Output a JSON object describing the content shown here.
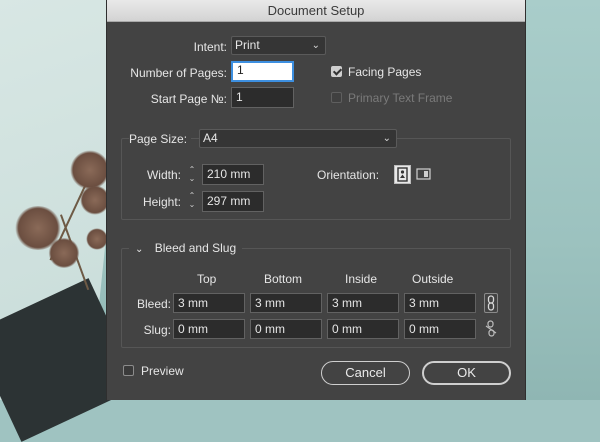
{
  "window": {
    "title": "Document Setup"
  },
  "intent": {
    "label": "Intent:",
    "value": "Print"
  },
  "pages": {
    "label": "Number of Pages:",
    "value": "1"
  },
  "start_page": {
    "label": "Start Page №:",
    "value": "1"
  },
  "facing_pages": {
    "label": "Facing Pages",
    "checked": true
  },
  "primary_text_frame": {
    "label": "Primary Text Frame",
    "checked": false,
    "disabled": true
  },
  "page_size": {
    "label": "Page Size:",
    "value": "A4"
  },
  "width": {
    "label": "Width:",
    "value": "210 mm"
  },
  "height": {
    "label": "Height:",
    "value": "297 mm"
  },
  "orientation": {
    "label": "Orientation:",
    "selected": "portrait"
  },
  "bleed_slug": {
    "title": "Bleed and Slug",
    "columns": [
      "Top",
      "Bottom",
      "Inside",
      "Outside"
    ],
    "bleed": {
      "label": "Bleed:",
      "values": [
        "3 mm",
        "3 mm",
        "3 mm",
        "3 mm"
      ],
      "linked": true
    },
    "slug": {
      "label": "Slug:",
      "values": [
        "0 mm",
        "0 mm",
        "0 mm",
        "0 mm"
      ],
      "linked": false
    }
  },
  "preview": {
    "label": "Preview",
    "checked": false
  },
  "buttons": {
    "cancel": "Cancel",
    "ok": "OK"
  },
  "icons": {
    "spinner": "up-down-arrows",
    "link": "chain-link-icon",
    "unlink": "broken-chain-icon",
    "chevron": "chevron-down-icon",
    "portrait": "portrait-page-icon",
    "landscape": "landscape-page-icon"
  }
}
